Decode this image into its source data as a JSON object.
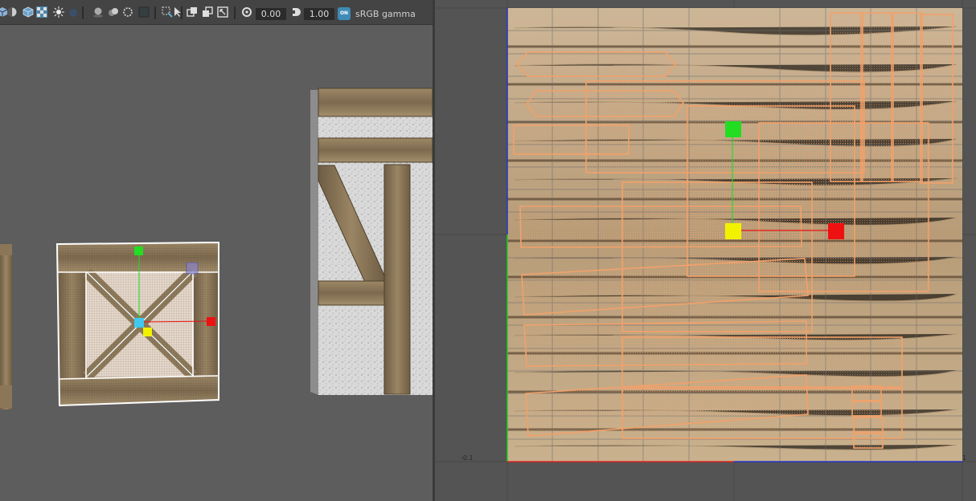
{
  "toolbar": {
    "field_1_value": "0.00",
    "field_2_value": "1.00",
    "colorspace_badge": "ON",
    "colorspace_label": "sRGB gamma",
    "icons": [
      "shaded-cube-icon",
      "half-sphere-icon",
      "wire-cube-icon",
      "checker-icon",
      "light-icon",
      "sphere-dark-icon",
      "sphere-group-icon",
      "spheres-icon",
      "dotted-circle-icon",
      "dark-square-icon",
      "select-box-icon",
      "cursor-icon",
      "copy-icon",
      "stack-icon",
      "scale-icon",
      "reset-icon",
      "exposure-icon",
      "colorspace-icon"
    ]
  },
  "uv_editor": {
    "axis_label_u": "-0.1",
    "axis_label_right": "1"
  },
  "colors": {
    "accent_uv_shell": "#f2a16a",
    "handle_green": "#22dd22",
    "handle_red": "#ee1111",
    "handle_yellow": "#f2f200",
    "handle_cyan": "#40c8f0",
    "axis_blue": "#2233cc",
    "axis_green": "#22cc22",
    "axis_red": "#dd2222"
  }
}
